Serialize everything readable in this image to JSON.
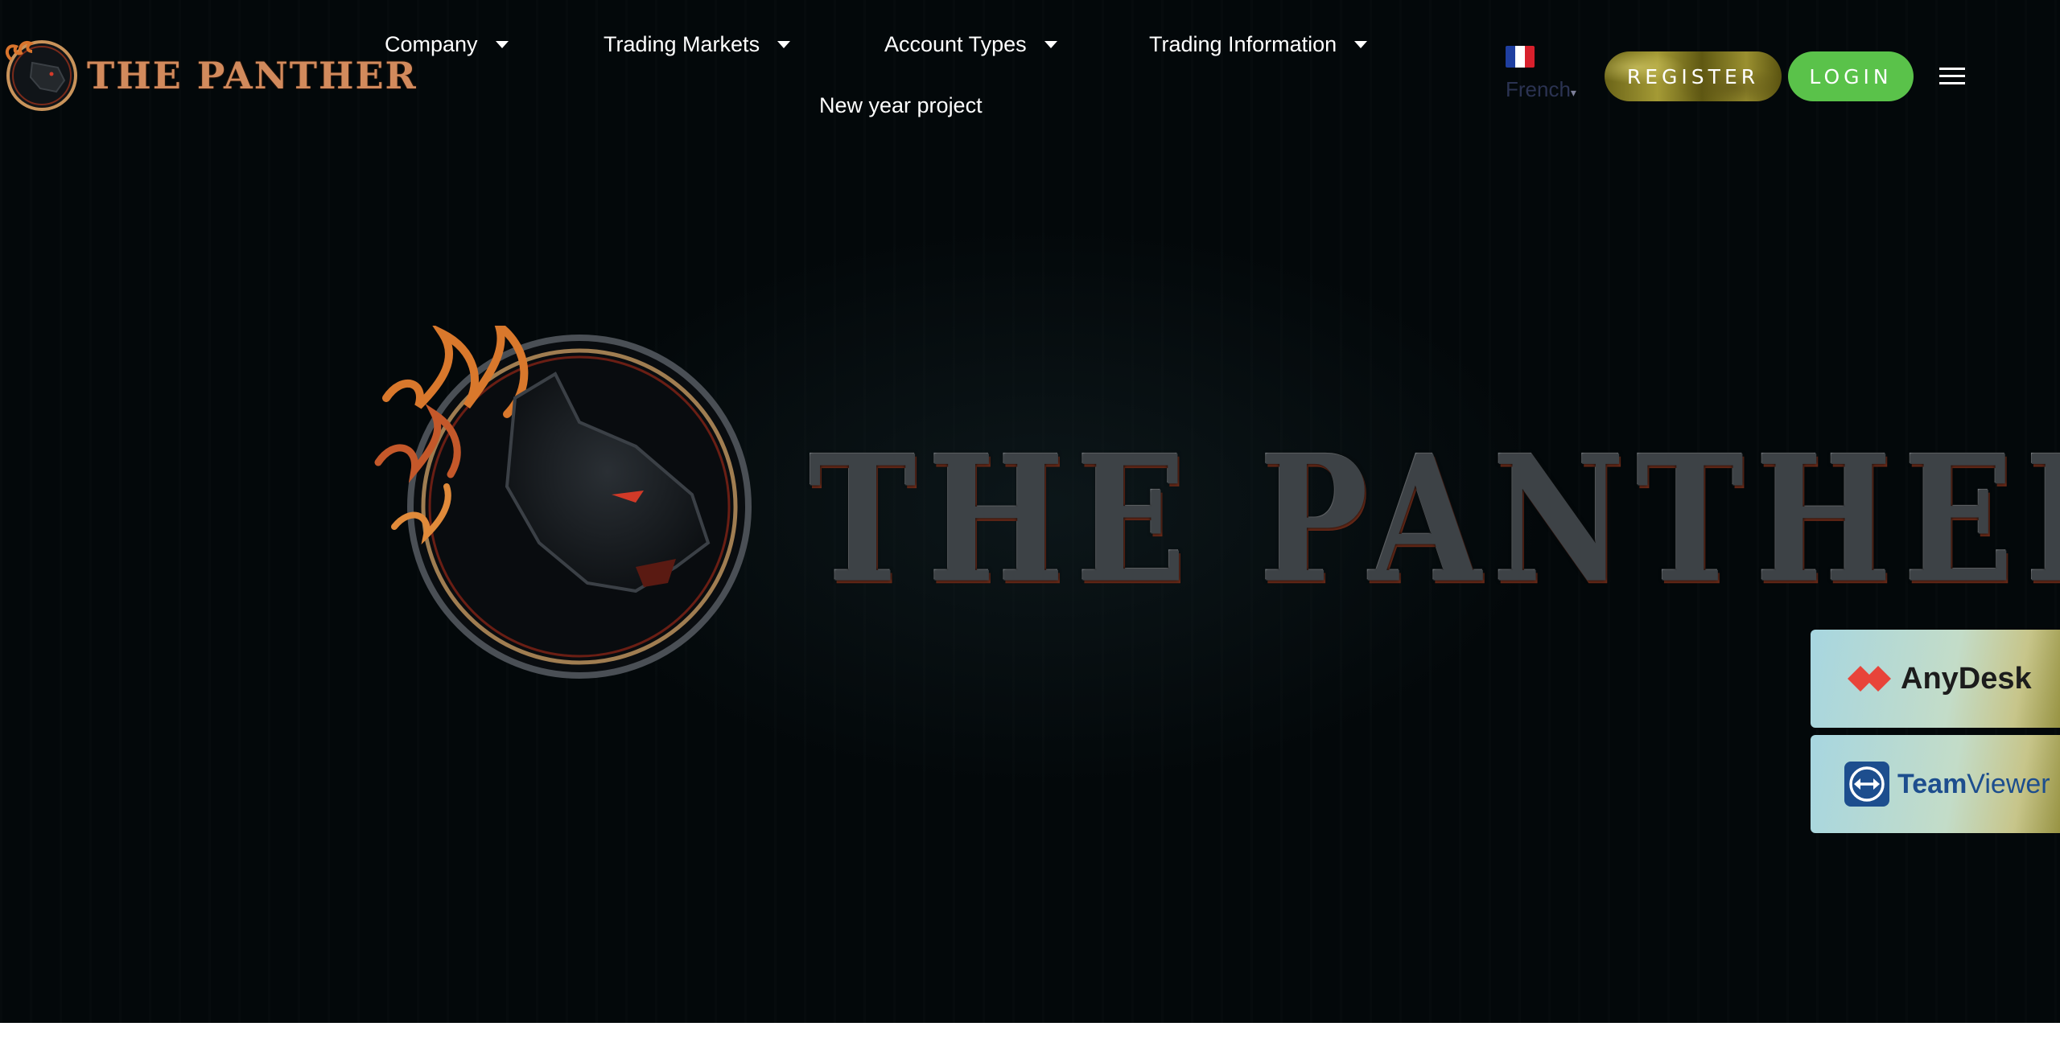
{
  "brand": {
    "name": "THE PANTHER"
  },
  "nav": {
    "items": [
      {
        "label": "Company"
      },
      {
        "label": "Trading Markets"
      },
      {
        "label": "Account Types"
      },
      {
        "label": "Trading Information"
      }
    ],
    "extra": {
      "label": "New year project"
    }
  },
  "language": {
    "label": "French",
    "caret": "▾",
    "flag_colors": [
      "#1f3fa0",
      "#ffffff",
      "#d8202c"
    ]
  },
  "buttons": {
    "register": "REGISTER",
    "login": "LOGIN"
  },
  "hero": {
    "title": "THE PANTHER"
  },
  "widgets": {
    "anydesk": "AnyDesk",
    "teamviewer_bold": "Team",
    "teamviewer_light": "Viewer"
  },
  "colors": {
    "background": "#03080a",
    "login_green": "#5ac24a",
    "register_gold": "#a49a35",
    "brand_copper": "#d28a5c",
    "anydesk_red": "#e8443a",
    "teamviewer_blue": "#1d4e8e"
  }
}
